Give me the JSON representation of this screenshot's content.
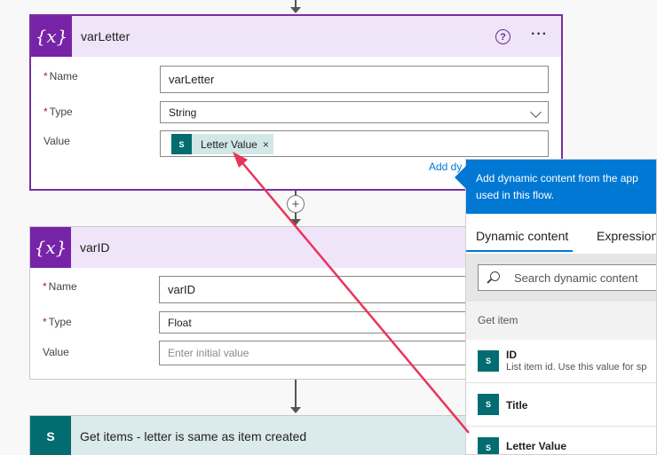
{
  "card1": {
    "title": "varLetter",
    "icon_text": "{x}",
    "name_label": "Name",
    "name_value": "varLetter",
    "type_label": "Type",
    "type_value": "String",
    "value_label": "Value",
    "token_label": "Letter Value",
    "token_icon_text": "S",
    "token_remove": "×",
    "add_dynamic_link": "Add dy",
    "help_icon": "?",
    "more_icon": "···"
  },
  "card2": {
    "title": "varID",
    "icon_text": "{x}",
    "name_label": "Name",
    "name_value": "varID",
    "type_label": "Type",
    "type_value": "Float",
    "value_label": "Value",
    "value_placeholder": "Enter initial value"
  },
  "card3": {
    "title": "Get items - letter is same as item created",
    "icon_text": "S"
  },
  "required_mark": "*",
  "add_step_icon": "+",
  "dynamic_panel": {
    "callout": [
      "Add dynamic content from the app",
      "used in this flow."
    ],
    "tabs": [
      "Dynamic content",
      "Expression"
    ],
    "search_placeholder": "Search dynamic content",
    "section": "Get item",
    "items": [
      {
        "name": "ID",
        "desc": "List item id. Use this value for sp",
        "icon_text": "S"
      },
      {
        "name": "Title",
        "desc": "",
        "icon_text": "S"
      },
      {
        "name": "Letter Value",
        "desc": "",
        "icon_text": "S"
      }
    ]
  },
  "colors": {
    "variable_purple": "#7723a8",
    "header_lavender": "#f0e4f8",
    "sharepoint_teal": "#036c70",
    "accent_blue": "#0078d4",
    "annotation_arrow": "#e8345a"
  }
}
